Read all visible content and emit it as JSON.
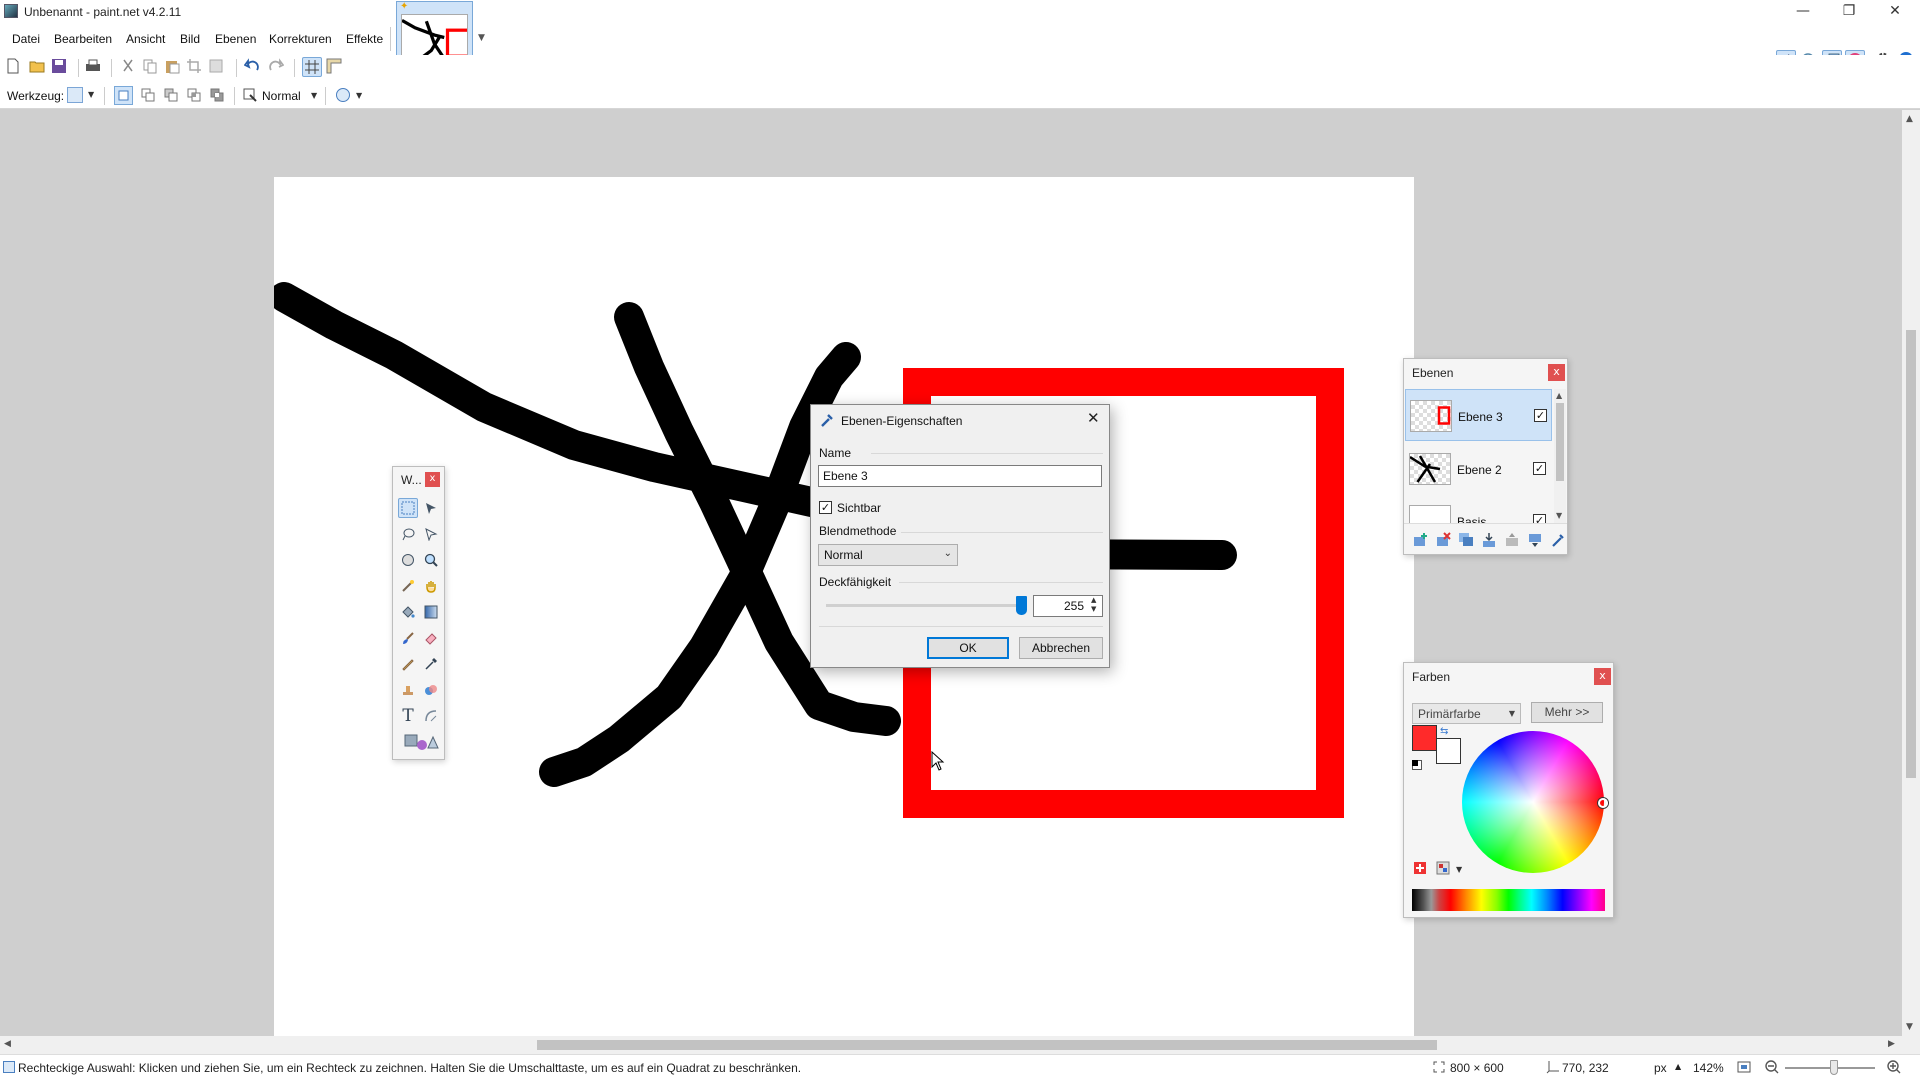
{
  "window": {
    "title": "Unbenannt - paint.net v4.2.11",
    "controls": {
      "minimize": "—",
      "restore": "❐",
      "close": "✕"
    }
  },
  "menu": [
    "Datei",
    "Bearbeiten",
    "Ansicht",
    "Bild",
    "Ebenen",
    "Korrekturen",
    "Effekte"
  ],
  "toolbar2": {
    "tool_label": "Werkzeug:",
    "blend_mode": "Normal"
  },
  "tools_window": {
    "title": "W...",
    "close": "x"
  },
  "layers_window": {
    "title": "Ebenen",
    "close": "x",
    "layers": [
      {
        "name": "Ebene 3",
        "visible": true,
        "selected": true
      },
      {
        "name": "Ebene 2",
        "visible": true,
        "selected": false
      },
      {
        "name": "Basis",
        "visible": true,
        "selected": false
      }
    ]
  },
  "colors_window": {
    "title": "Farben",
    "close": "x",
    "mode": "Primärfarbe",
    "more_button": "Mehr >>",
    "primary_color": "#ff0000",
    "secondary_color": "#ffffff"
  },
  "dialog": {
    "title": "Ebenen-Eigenschaften",
    "name_label": "Name",
    "name_value": "Ebene 3",
    "visible_label": "Sichtbar",
    "visible_checked": true,
    "blend_label": "Blendmethode",
    "blend_value": "Normal",
    "opacity_label": "Deckfähigkeit",
    "opacity_value": "255",
    "ok": "OK",
    "cancel": "Abbrechen"
  },
  "status": {
    "hint": "Rechteckige Auswahl: Klicken und ziehen Sie, um ein Rechteck zu zeichnen. Halten Sie die Umschalttaste, um es auf ein Quadrat zu beschränken.",
    "image_size": "800 × 600",
    "cursor_pos": "770, 232",
    "unit": "px",
    "zoom": "142%"
  },
  "colors": {
    "accent": "#0078d7",
    "stroke": "#000000",
    "rect": "#ff0000"
  }
}
